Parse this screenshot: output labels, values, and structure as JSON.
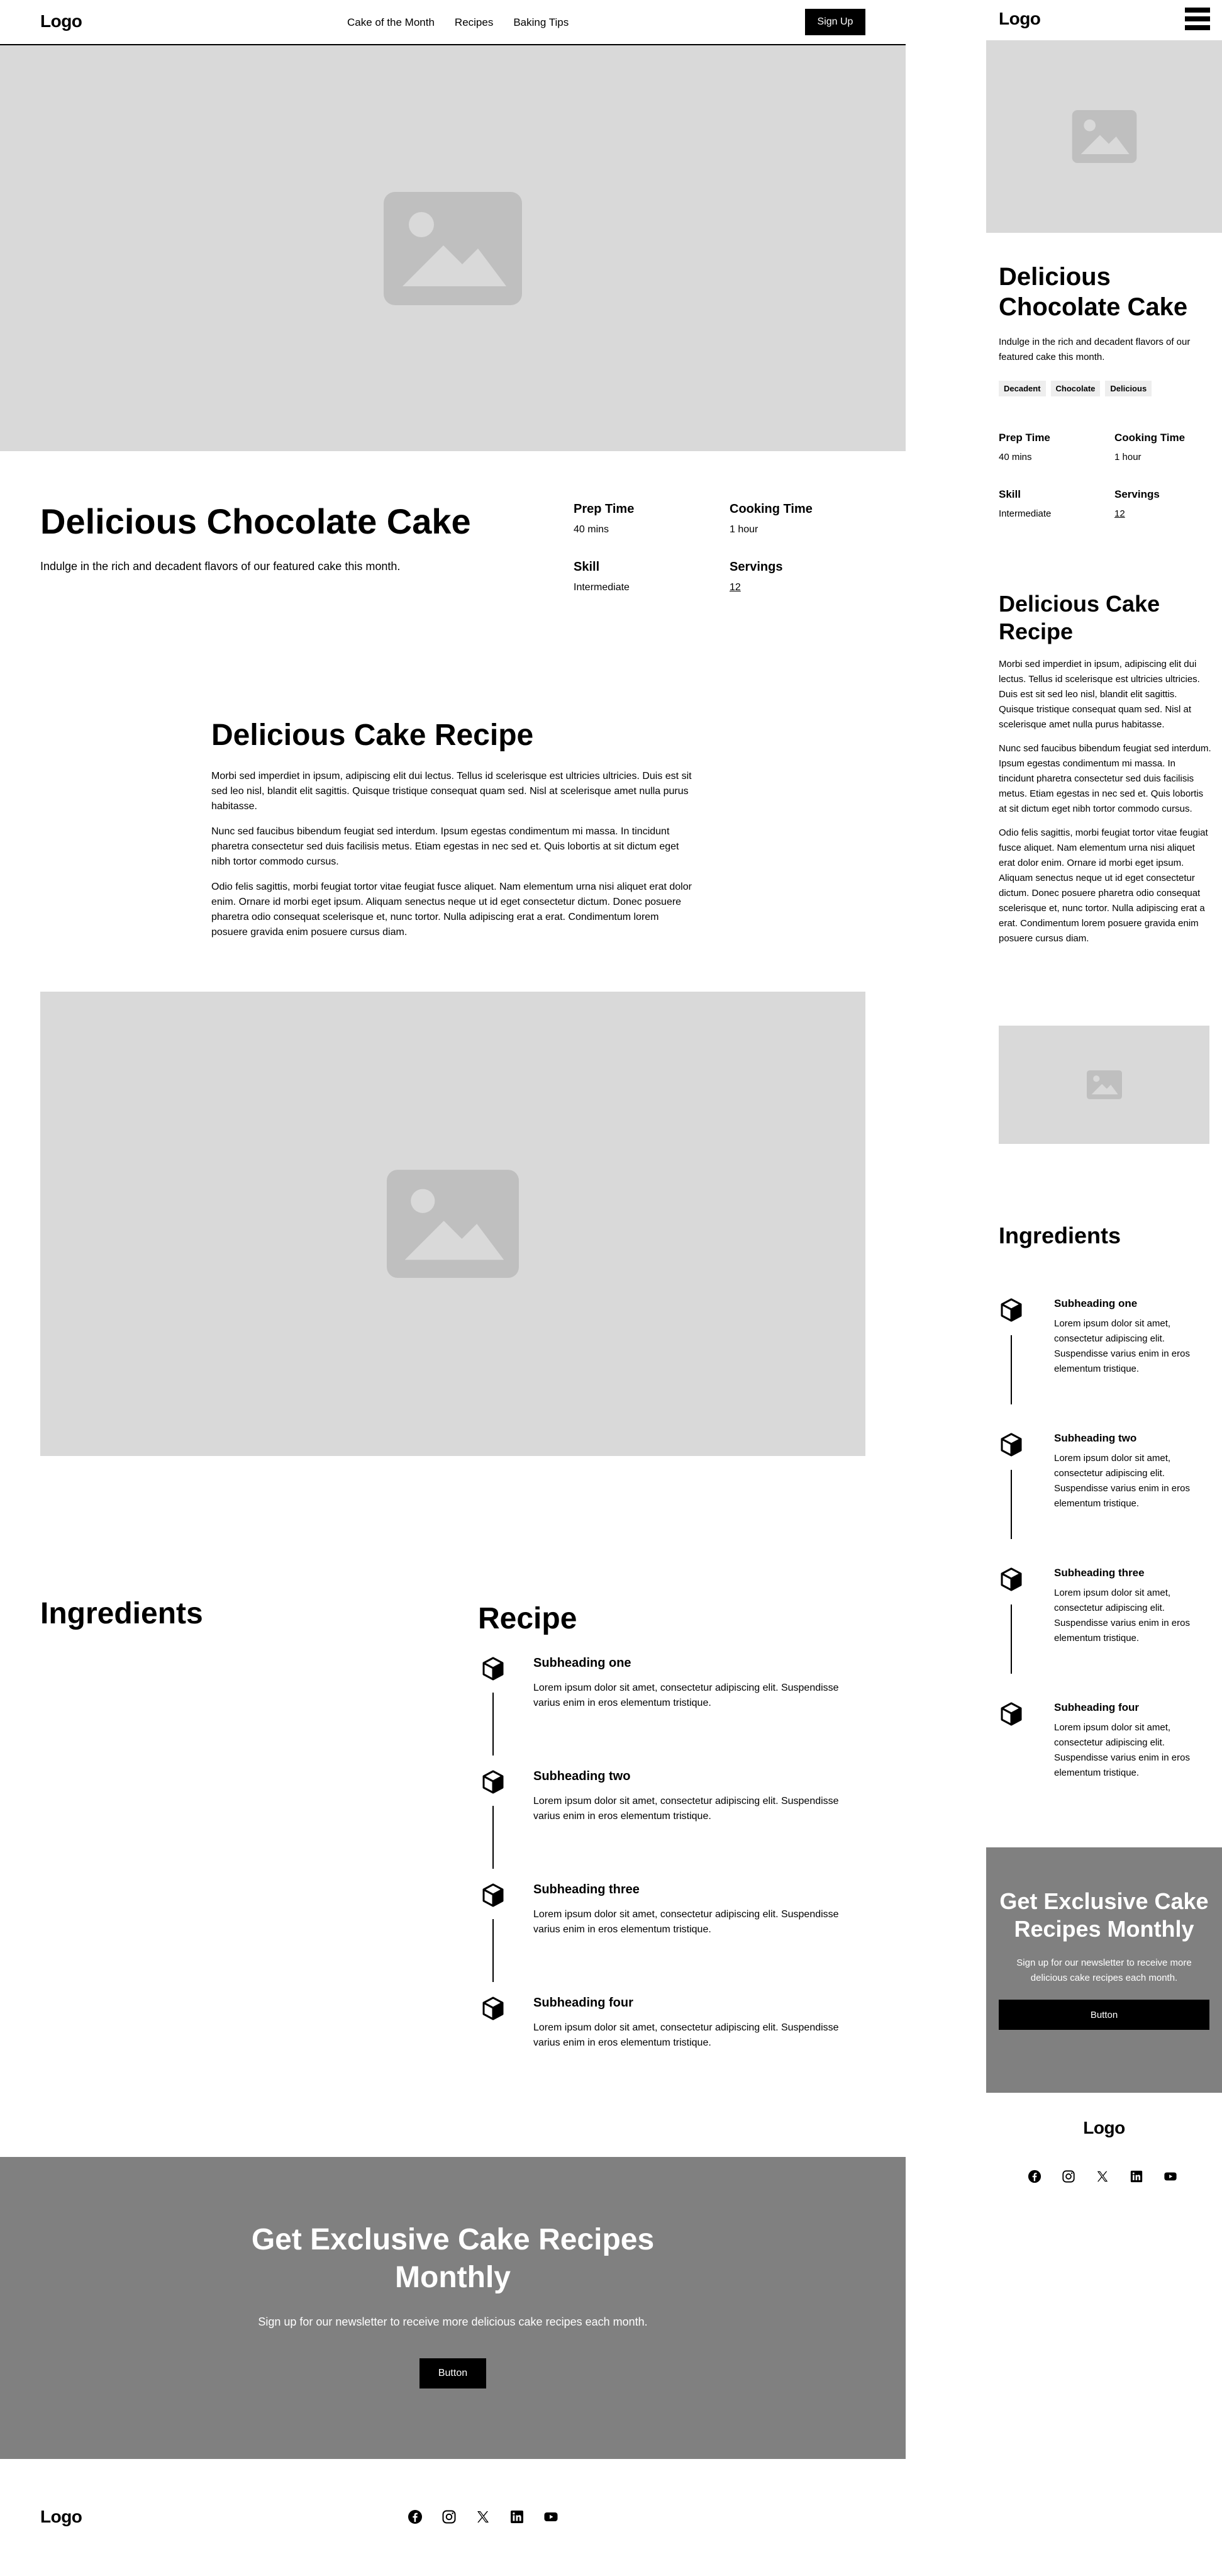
{
  "nav": {
    "logo": "Logo",
    "links": [
      "Cake of the Month",
      "Recipes",
      "Baking Tips"
    ],
    "signup": "Sign Up"
  },
  "hero": {
    "title": "Delicious Chocolate Cake",
    "subtitle": "Indulge in the rich and decadent flavors of our featured cake this month."
  },
  "tags": [
    "Decadent",
    "Chocolate",
    "Delicious"
  ],
  "meta": {
    "prep_label": "Prep Time",
    "prep_value": "40 mins",
    "cook_label": "Cooking Time",
    "cook_value": "1 hour",
    "skill_label": "Skill",
    "skill_value": "Intermediate",
    "servings_label": "Servings",
    "servings_value": "12"
  },
  "recipe_section": {
    "title": "Delicious Cake Recipe",
    "paragraphs": [
      "Morbi sed imperdiet in ipsum, adipiscing elit dui lectus. Tellus id scelerisque est ultricies ultricies. Duis est sit sed leo nisl, blandit elit sagittis. Quisque tristique consequat quam sed. Nisl at scelerisque amet nulla purus habitasse.",
      "Nunc sed faucibus bibendum feugiat sed interdum. Ipsum egestas condimentum mi massa. In tincidunt pharetra consectetur sed duis facilisis metus. Etiam egestas in nec sed et. Quis lobortis at sit dictum eget nibh tortor commodo cursus.",
      "Odio felis sagittis, morbi feugiat tortor vitae feugiat fusce aliquet. Nam elementum urna nisi aliquet erat dolor enim. Ornare id morbi eget ipsum. Aliquam senectus neque ut id eget consectetur dictum. Donec posuere pharetra odio consequat scelerisque et, nunc tortor. Nulla adipiscing erat a erat. Condimentum lorem posuere gravida enim posuere cursus diam."
    ]
  },
  "ingredients_title": "Ingredients",
  "recipe_title": "Recipe",
  "steps": [
    {
      "heading": "Subheading one",
      "text": "Lorem ipsum dolor sit amet, consectetur adipiscing elit. Suspendisse varius enim in eros elementum tristique."
    },
    {
      "heading": "Subheading two",
      "text": "Lorem ipsum dolor sit amet, consectetur adipiscing elit. Suspendisse varius enim in eros elementum tristique."
    },
    {
      "heading": "Subheading three",
      "text": "Lorem ipsum dolor sit amet, consectetur adipiscing elit. Suspendisse varius enim in eros elementum tristique."
    },
    {
      "heading": "Subheading four",
      "text": "Lorem ipsum dolor sit amet, consectetur adipiscing elit. Suspendisse varius enim in eros elementum tristique."
    }
  ],
  "cta": {
    "title": "Get Exclusive Cake Recipes Monthly",
    "subtitle": "Sign up for our newsletter to receive more delicious cake recipes each month.",
    "button": "Button"
  },
  "footer": {
    "logo": "Logo",
    "social_icons": [
      "facebook-icon",
      "instagram-icon",
      "x-icon",
      "linkedin-icon",
      "youtube-icon"
    ]
  },
  "colors": {
    "placeholder_bg": "#d9d9d9",
    "placeholder_icon": "#bfbfbf",
    "cta_bg": "#808080",
    "button_bg": "#000000"
  }
}
